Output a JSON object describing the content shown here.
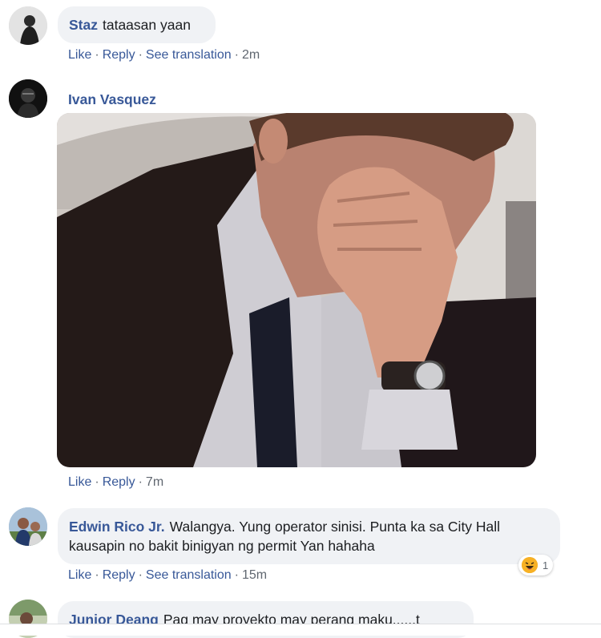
{
  "comments": [
    {
      "author": "Staz",
      "text": "tataasan yaan",
      "actions": {
        "like": "Like",
        "reply": "Reply",
        "translate": "See translation",
        "time": "2m"
      }
    },
    {
      "author": "Ivan Vasquez",
      "text": "",
      "actions": {
        "like": "Like",
        "reply": "Reply",
        "time": "7m"
      }
    },
    {
      "author": "Edwin Rico Jr.",
      "text": "Walangya. Yung operator sinisi. Punta ka sa City Hall kausapin no bakit binigyan ng permit Yan hahaha",
      "reaction": {
        "icon": "haha-emoji-icon",
        "count": "1"
      },
      "actions": {
        "like": "Like",
        "reply": "Reply",
        "translate": "See translation",
        "time": "15m"
      }
    },
    {
      "author": "Junior Deang",
      "text": "Pag may proyekto may perang maku......t"
    }
  ],
  "separator": "·",
  "colors": {
    "link": "#385898",
    "bubble": "#f0f2f5",
    "meta": "#606770"
  }
}
